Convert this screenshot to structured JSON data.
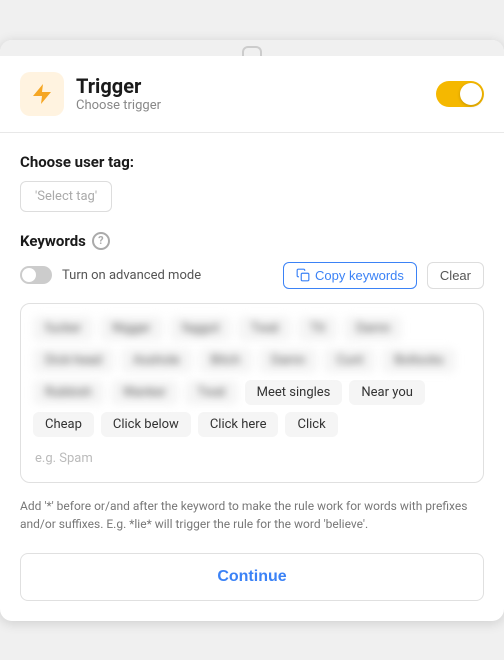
{
  "header": {
    "title": "Trigger",
    "subtitle": "Choose trigger",
    "toggle_state": "on"
  },
  "user_tag": {
    "label": "Choose user tag:",
    "placeholder": "'Select tag'"
  },
  "keywords": {
    "title": "Keywords",
    "help": "?",
    "advanced_mode_label": "Turn on advanced mode",
    "copy_label": "Copy keywords",
    "clear_label": "Clear",
    "tags_blurred": [
      "fucker",
      "Nigger",
      "faggot",
      "Twat",
      "Tit",
      "Damn",
      "Dick-head",
      "Asshole",
      "Bitch",
      "Damn",
      "Cunt",
      "Bollocks",
      "Rubbish",
      "Wanker",
      "Twat"
    ],
    "tags_normal": [
      "Meet singles",
      "Near you",
      "Cheap",
      "Click below",
      "Click here",
      "Click"
    ],
    "placeholder": "e.g. Spam"
  },
  "info_text": "Add '*' before or/and after the keyword to make the rule work for words with prefixes and/or suffixes. E.g. *lie* will trigger the rule for the word 'believe'.",
  "continue_button": "Continue"
}
